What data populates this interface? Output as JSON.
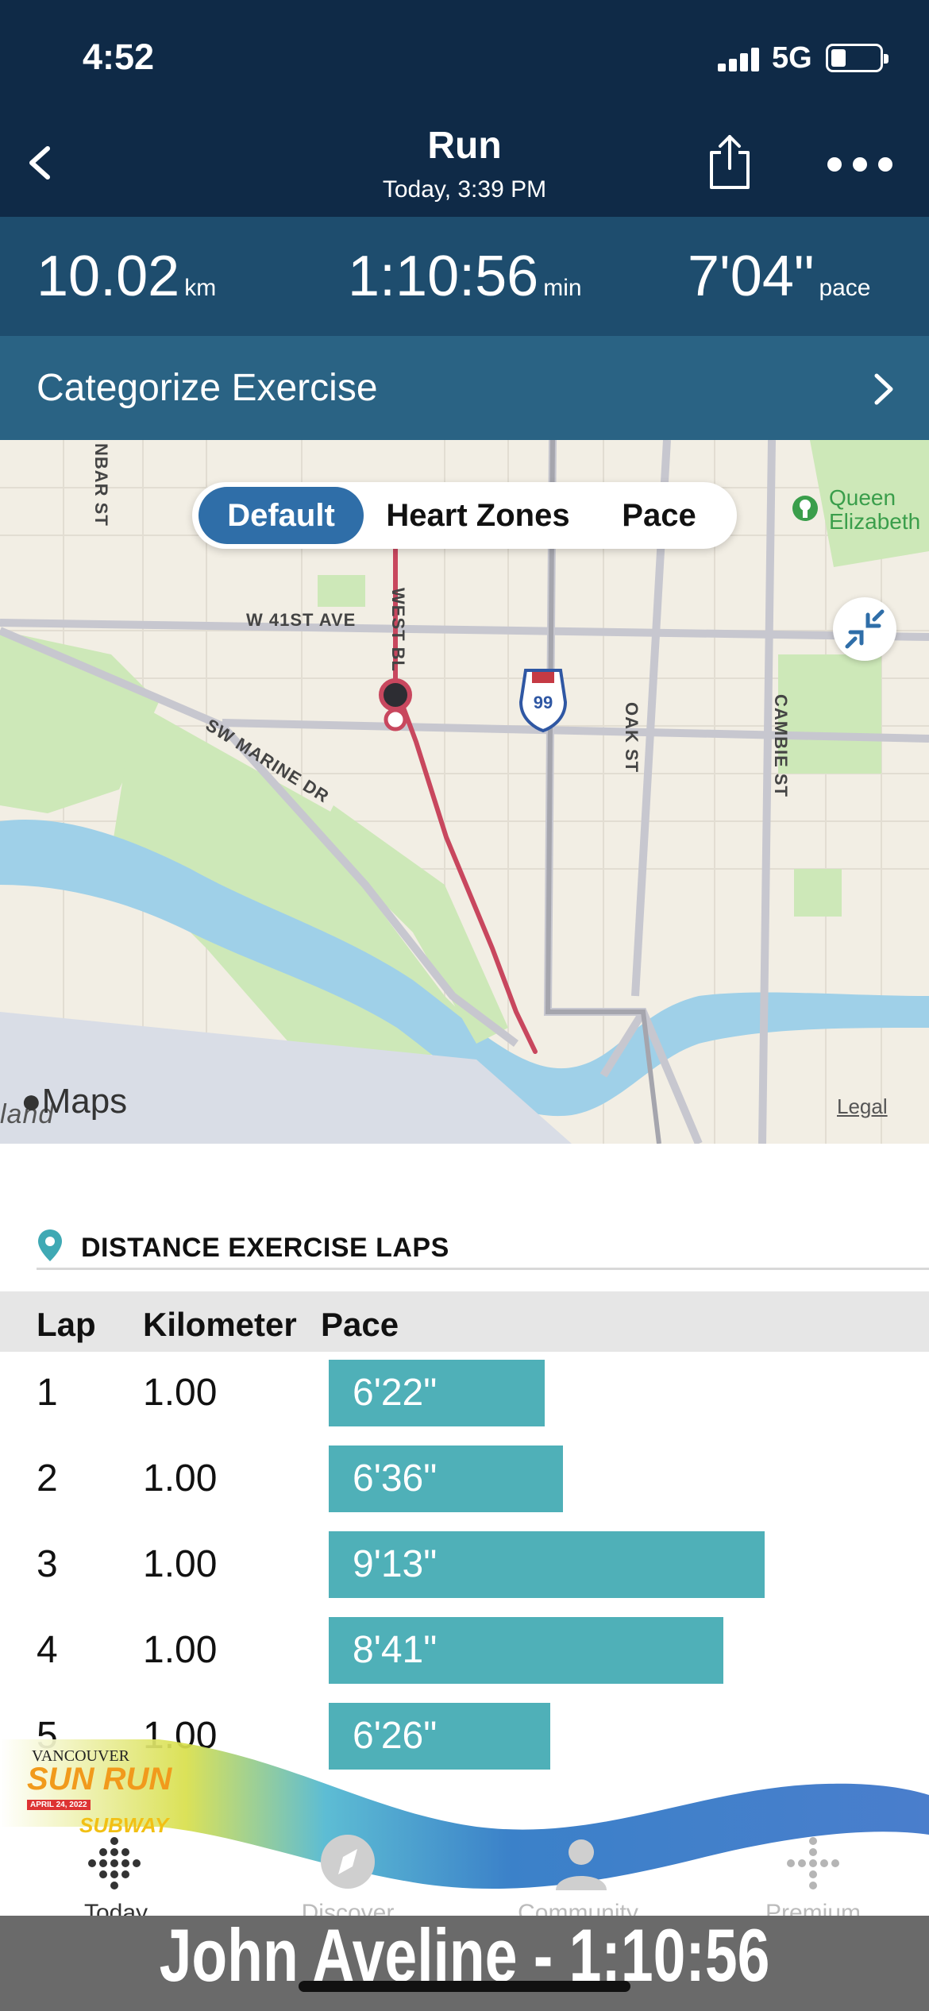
{
  "status_bar": {
    "time": "4:52",
    "network": "5G"
  },
  "nav": {
    "title": "Run",
    "subtitle": "Today, 3:39 PM"
  },
  "stats": [
    {
      "value": "10.02",
      "unit": "km"
    },
    {
      "value": "1:10:56",
      "unit": "min"
    },
    {
      "value": "7'04\"",
      "unit": "pace"
    }
  ],
  "categorize": {
    "label": "Categorize Exercise"
  },
  "map": {
    "segments": [
      "Default",
      "Heart Zones",
      "Pace"
    ],
    "selected_segment": "Default",
    "labels": {
      "w41": "W 41ST AVE",
      "sw_marine": "SW MARINE DR",
      "oak": "OAK ST",
      "cambie": "CAMBIE ST",
      "nbar": "NBAR ST",
      "west_blvd": "WEST BL",
      "highway": "99",
      "queen_line1": "Queen",
      "queen_line2": "Elizabeth",
      "island": "land"
    },
    "brand": "Maps",
    "legal": "Legal"
  },
  "laps": {
    "title": "DISTANCE EXERCISE LAPS",
    "headers": [
      "Lap",
      "Kilometer",
      "Pace"
    ],
    "rows": [
      {
        "lap": "1",
        "km": "1.00",
        "pace": "6'22\"",
        "seconds": 382
      },
      {
        "lap": "2",
        "km": "1.00",
        "pace": "6'36\"",
        "seconds": 396
      },
      {
        "lap": "3",
        "km": "1.00",
        "pace": "9'13\"",
        "seconds": 553
      },
      {
        "lap": "4",
        "km": "1.00",
        "pace": "8'41\"",
        "seconds": 521
      },
      {
        "lap": "5",
        "km": "1.00",
        "pace": "6'26\"",
        "seconds": 386
      }
    ]
  },
  "tabs": [
    "Today",
    "Discover",
    "Community",
    "Premium"
  ],
  "active_tab": "Today",
  "overlay": {
    "event_logo_line1": "VANCOUVER",
    "event_logo_line2": "SUN RUN",
    "event_date": "APRIL 24, 2022",
    "sponsor": "SUBWAY",
    "caption": "John Aveline - 1:10:56"
  },
  "colors": {
    "nav": "#0f2a47",
    "stats": "#1e4d6e",
    "categorize": "#2a6384",
    "lap_bar": "#4fb0b8",
    "route": "#c8475e",
    "segment_active": "#2f6ea8"
  }
}
